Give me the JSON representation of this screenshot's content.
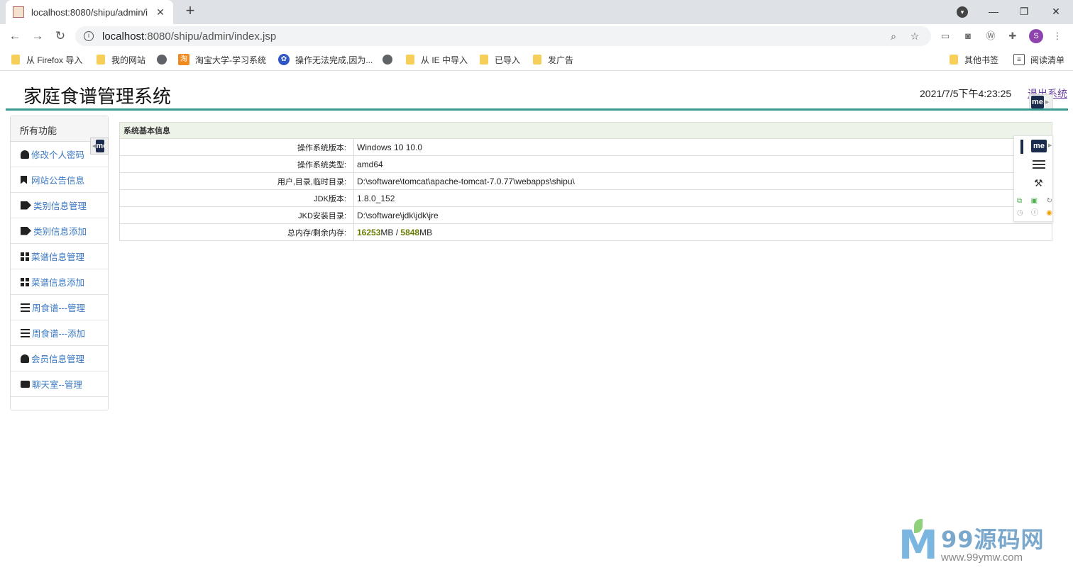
{
  "browser": {
    "tab_title": "localhost:8080/shipu/admin/i",
    "url_host": "localhost",
    "url_rest": ":8080/shipu/admin/index.jsp",
    "avatar_letter": "S",
    "bookmarks": [
      "从 Firefox 导入",
      "我的网站",
      "淘宝大学-学习系统",
      "操作无法完成,因为...",
      "从 IE 中导入",
      "已导入",
      "发广告",
      "其他书签",
      "阅读清单"
    ]
  },
  "header": {
    "title": "家庭食谱管理系统",
    "clock": "2021/7/5下午4:23:25",
    "logout": "退出系统"
  },
  "sidebar": {
    "heading": "所有功能",
    "items": [
      {
        "label": "修改个人密码",
        "icon": "user-icon"
      },
      {
        "label": "网站公告信息",
        "icon": "bookmark-icon"
      },
      {
        "label": "类别信息管理",
        "icon": "tags-icon"
      },
      {
        "label": "类别信息添加",
        "icon": "tags-icon"
      },
      {
        "label": "菜谱信息管理",
        "icon": "grid-icon"
      },
      {
        "label": "菜谱信息添加",
        "icon": "grid-icon"
      },
      {
        "label": "周食谱---管理",
        "icon": "list-icon"
      },
      {
        "label": "周食谱---添加",
        "icon": "list-icon"
      },
      {
        "label": "会员信息管理",
        "icon": "user-icon"
      },
      {
        "label": "聊天室--管理",
        "icon": "comment-icon"
      }
    ]
  },
  "system_info": {
    "heading": "系统基本信息",
    "rows": [
      {
        "label": "操作系统版本:",
        "value": "Windows 10  10.0"
      },
      {
        "label": "操作系统类型:",
        "value": "amd64"
      },
      {
        "label": "用户,目录,临时目录:",
        "value": "D:\\software\\tomcat\\apache-tomcat-7.0.77\\webapps\\shipu\\"
      },
      {
        "label": "JDK版本:",
        "value": "1.8.0_152"
      },
      {
        "label": "JKD安装目录:",
        "value": "D:\\software\\jdk\\jdk\\jre"
      }
    ],
    "memory": {
      "label": "总内存/剩余内存:",
      "total": "16253",
      "free": "5848",
      "unit": "MB",
      "sep": " / "
    }
  },
  "extension": {
    "badge": "me"
  },
  "watermark": {
    "brand": "99源码网",
    "url": "www.99ymw.com"
  },
  "colors": {
    "accent_rule": "#3a9a92",
    "link": "#3a78c2",
    "table_head": "#eef3e9"
  }
}
